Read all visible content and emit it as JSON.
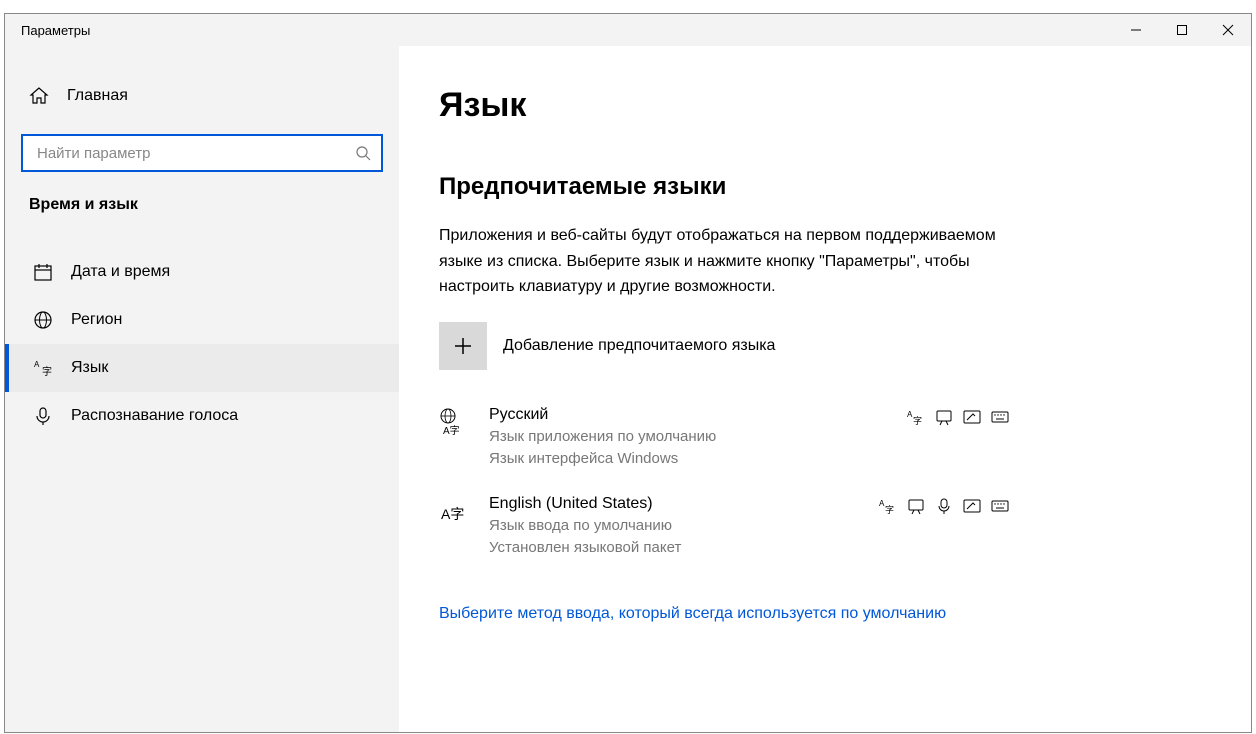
{
  "titlebar": {
    "title": "Параметры"
  },
  "sidebar": {
    "home_label": "Главная",
    "search_placeholder": "Найти параметр",
    "category_label": "Время и язык",
    "items": [
      {
        "label": "Дата и время"
      },
      {
        "label": "Регион"
      },
      {
        "label": "Язык"
      },
      {
        "label": "Распознавание голоса"
      }
    ]
  },
  "main": {
    "heading": "Язык",
    "section_title": "Предпочитаемые языки",
    "section_desc": "Приложения и веб-сайты будут отображаться на первом поддерживаемом языке из списка. Выберите язык и нажмите кнопку \"Параметры\", чтобы настроить клавиатуру и другие возможности.",
    "add_language_label": "Добавление предпочитаемого языка",
    "languages": [
      {
        "name": "Русский",
        "sub1": "Язык приложения по умолчанию",
        "sub2": "Язык интерфейса Windows"
      },
      {
        "name": "English (United States)",
        "sub1": "Язык ввода по умолчанию",
        "sub2": "Установлен языковой пакет"
      }
    ],
    "link_text": "Выберите метод ввода, который всегда используется по умолчанию"
  }
}
